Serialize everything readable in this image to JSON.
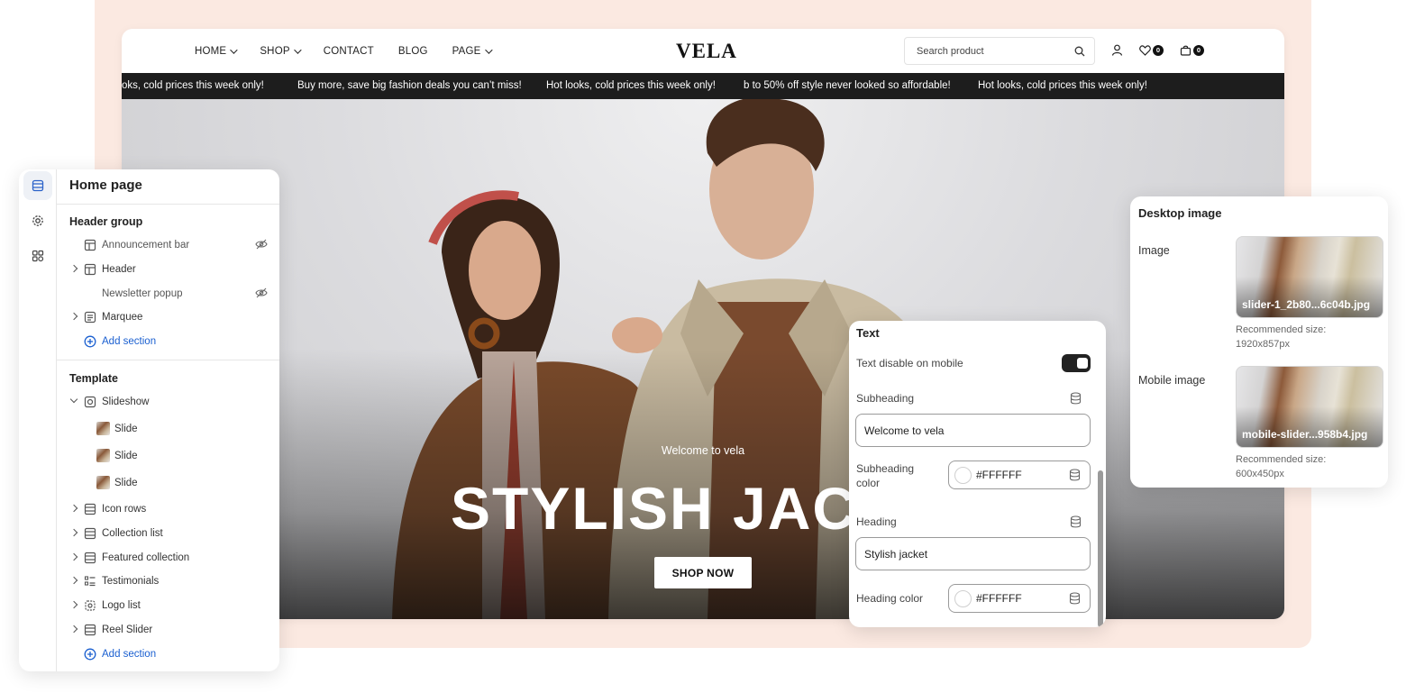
{
  "storefront": {
    "menu": [
      {
        "label": "HOME",
        "dropdown": true
      },
      {
        "label": "SHOP",
        "dropdown": true
      },
      {
        "label": "CONTACT",
        "dropdown": false
      },
      {
        "label": "BLOG",
        "dropdown": false
      },
      {
        "label": "PAGE",
        "dropdown": true
      }
    ],
    "logo": "VELA",
    "search_placeholder": "Search product",
    "wishlist_count": "0",
    "cart_count": "0",
    "marquee": [
      "oks, cold prices this week only!",
      "Buy more, save big fashion deals you can’t miss!",
      "Hot looks, cold prices this week only!",
      "b to 50% off style never looked so affordable!",
      "Hot looks, cold prices this week only!"
    ],
    "hero": {
      "subheading": "Welcome to vela",
      "heading": "STYLISH JACKET",
      "button": "SHOP NOW"
    }
  },
  "editor": {
    "title": "Home page",
    "header_group_title": "Header group",
    "header_group": [
      {
        "label": "Announcement bar",
        "hidden": true,
        "expandable": false
      },
      {
        "label": "Header",
        "hidden": false,
        "expandable": true
      },
      {
        "label": "Newsletter popup",
        "hidden": true,
        "expandable": false
      },
      {
        "label": "Marquee",
        "hidden": false,
        "expandable": true
      }
    ],
    "add_section": "Add section",
    "template_title": "Template",
    "slideshow": "Slideshow",
    "slides": [
      "Slide",
      "Slide",
      "Slide"
    ],
    "template_sections": [
      "Icon rows",
      "Collection list",
      "Featured collection",
      "Testimonials",
      "Logo list",
      "Reel Slider"
    ]
  },
  "text_panel": {
    "title": "Text",
    "disable_mobile_label": "Text disable on mobile",
    "disable_mobile_on": true,
    "subheading_label": "Subheading",
    "subheading_value": "Welcome to vela",
    "subheading_color_label": "Subheading color",
    "subheading_color": "#FFFFFF",
    "heading_label": "Heading",
    "heading_value": "Stylish jacket",
    "heading_color_label": "Heading color",
    "heading_color": "#FFFFFF"
  },
  "image_panel": {
    "title": "Desktop image",
    "image_label": "Image",
    "image_file": "slider-1_2b80...6c04b.jpg",
    "image_rec_label": "Recommended size:",
    "image_rec_size": "1920x857px",
    "mobile_label": "Mobile image",
    "mobile_file": "mobile-slider...958b4.jpg",
    "mobile_rec_label": "Recommended size:",
    "mobile_rec_size": "600x450px"
  },
  "colors": {
    "backdrop": "#fbe9e1",
    "marquee_bg": "#1d1d1d",
    "link_blue": "#1a5fd0",
    "toggle_on": "#222222"
  }
}
